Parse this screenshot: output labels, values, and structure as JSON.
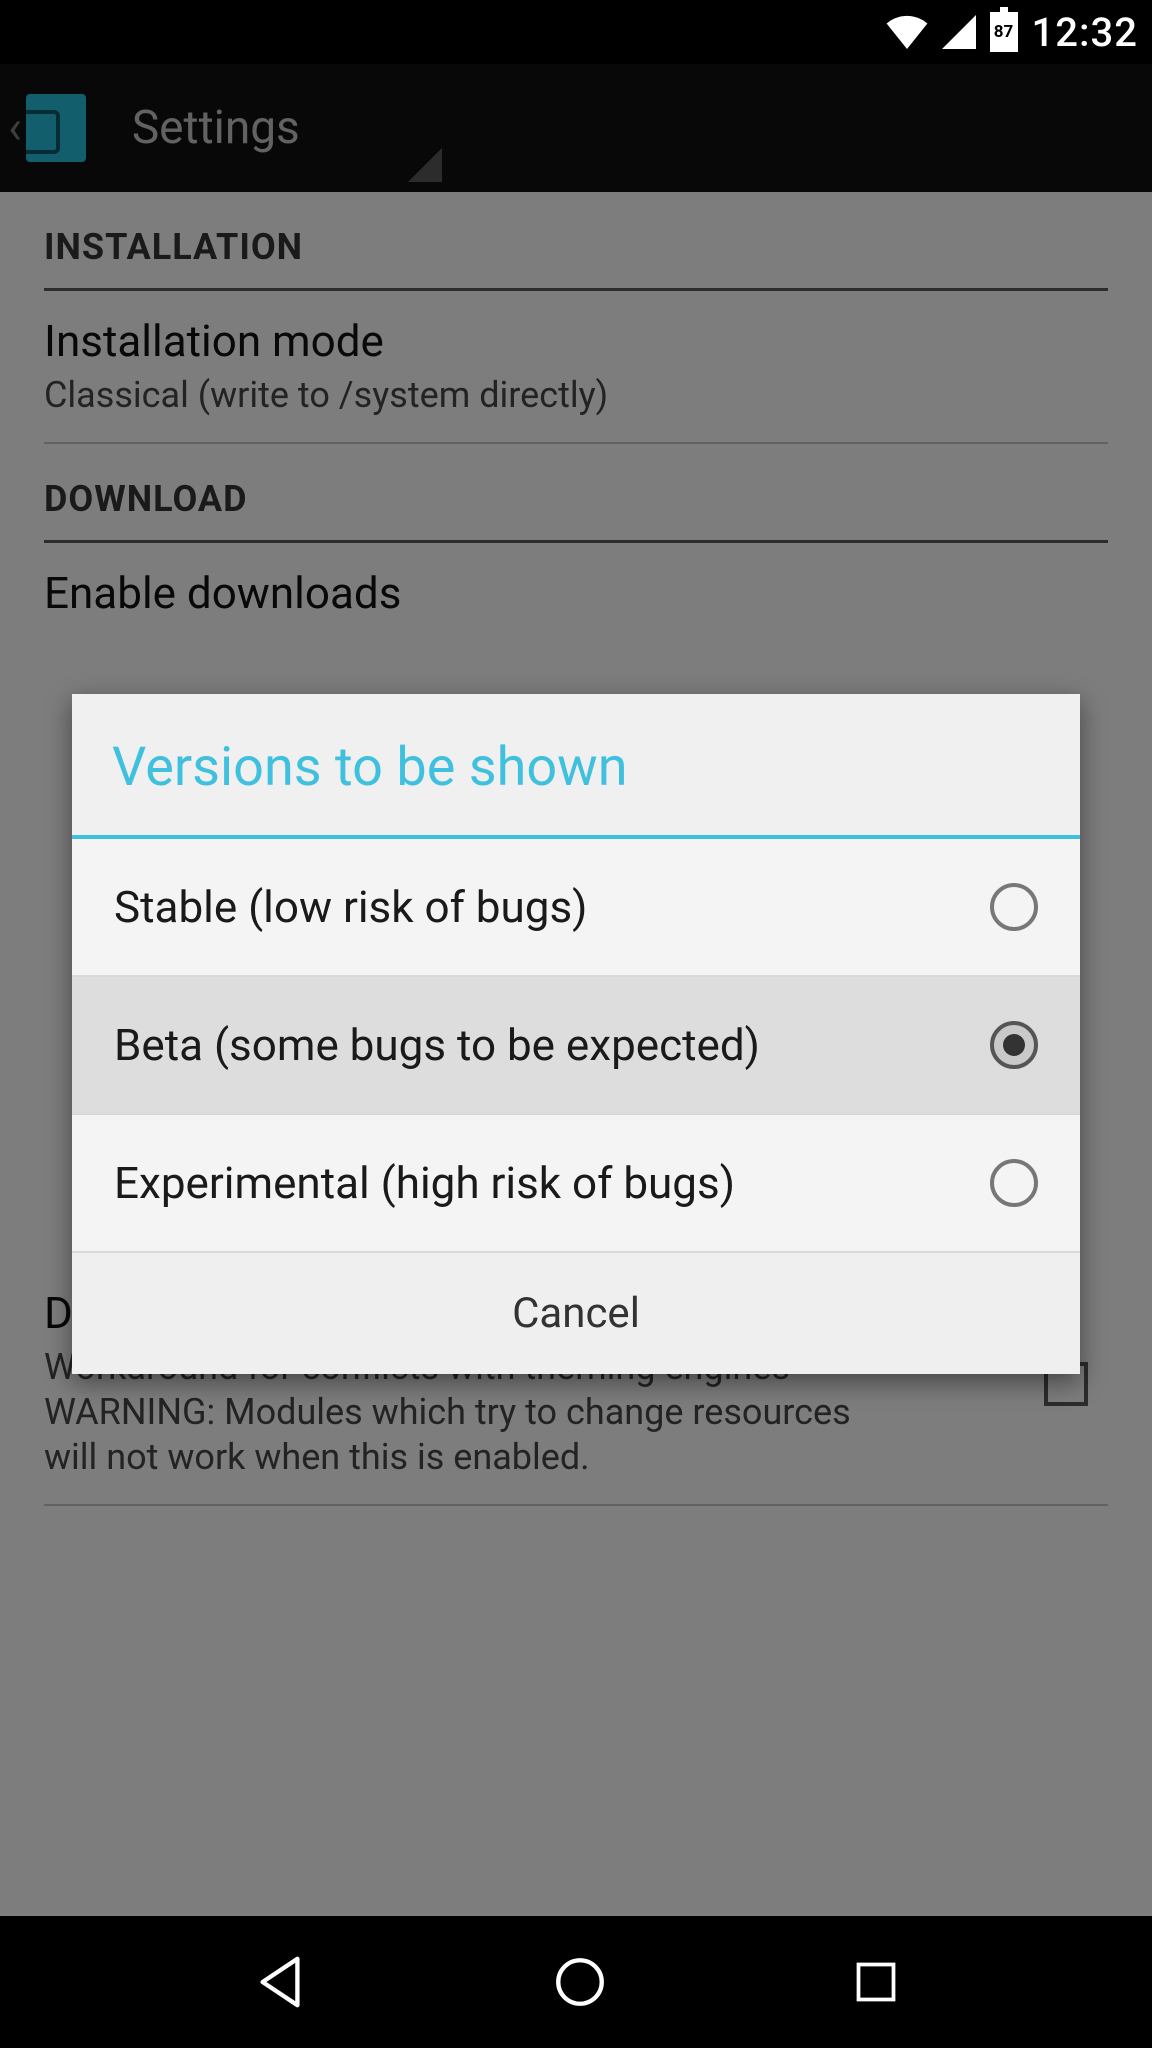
{
  "status": {
    "battery_level": "87",
    "clock": "12:32"
  },
  "actionbar": {
    "title": "Settings"
  },
  "sections": {
    "installation_header": "INSTALLATION",
    "download_header": "DOWNLOAD"
  },
  "settings": {
    "installation_mode": {
      "title": "Installation mode",
      "subtitle": "Classical (write to /system directly)"
    },
    "enable_downloads": {
      "title": "Enable downloads"
    },
    "disabled_hooks": {
      "title": "Disabled resource hooks",
      "subtitle": "Workaround for conflicts with theming engines WARNING: Modules which try to change resources will not work when this is enabled."
    }
  },
  "dialog": {
    "title": "Versions to be shown",
    "options": [
      {
        "label": "Stable (low risk of bugs)",
        "selected": false
      },
      {
        "label": "Beta (some bugs to be expected)",
        "selected": true
      },
      {
        "label": "Experimental (high risk of bugs)",
        "selected": false
      }
    ],
    "cancel": "Cancel"
  }
}
